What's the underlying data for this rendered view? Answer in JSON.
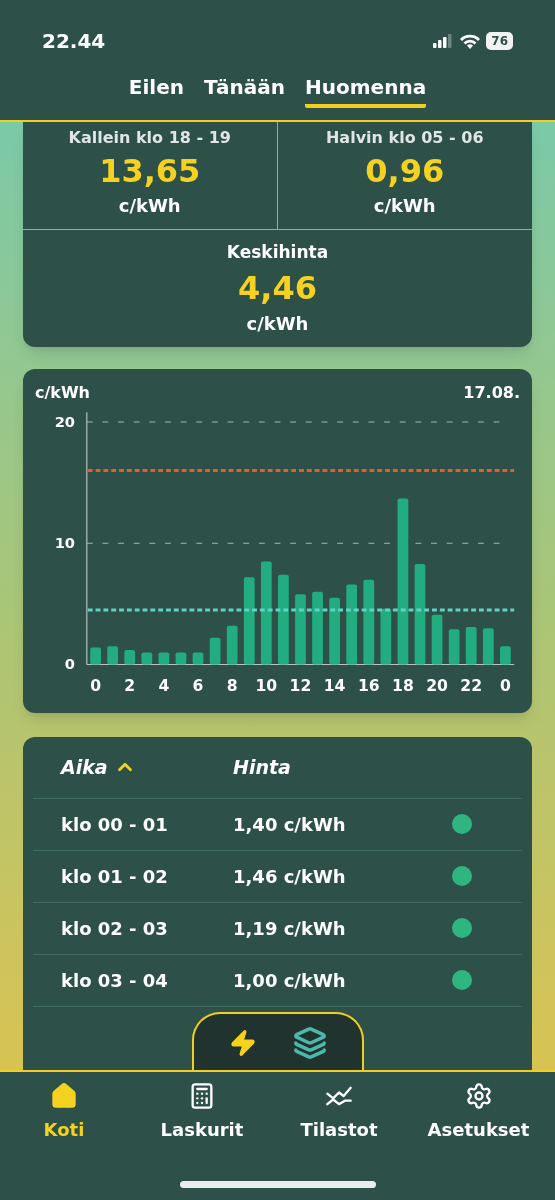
{
  "status_bar": {
    "time": "22.44",
    "battery": "76"
  },
  "tabs": [
    {
      "label": "Eilen",
      "selected": false
    },
    {
      "label": "Tänään",
      "selected": false
    },
    {
      "label": "Huomenna",
      "selected": true
    }
  ],
  "summary": {
    "highest": {
      "label": "Kallein klo 18 - 19",
      "value": "13,65",
      "unit": "c/kWh"
    },
    "lowest": {
      "label": "Halvin klo 05 - 06",
      "value": "0,96",
      "unit": "c/kWh"
    },
    "average": {
      "label": "Keskihinta",
      "value": "4,46",
      "unit": "c/kWh"
    }
  },
  "chart": {
    "date": "17.08.",
    "next_day_tick": "0",
    "chart_data": {
      "type": "bar",
      "ylabel": "c/kWh",
      "x": [
        0,
        1,
        2,
        3,
        4,
        5,
        6,
        7,
        8,
        9,
        10,
        11,
        12,
        13,
        14,
        15,
        16,
        17,
        18,
        19,
        20,
        21,
        22,
        23,
        24
      ],
      "xticks": [
        {
          "value": 0,
          "label": "0"
        },
        {
          "value": 2,
          "label": "2"
        },
        {
          "value": 4,
          "label": "4"
        },
        {
          "value": 6,
          "label": "6"
        },
        {
          "value": 8,
          "label": "8"
        },
        {
          "value": 10,
          "label": "10"
        },
        {
          "value": 12,
          "label": "12"
        },
        {
          "value": 14,
          "label": "14"
        },
        {
          "value": 16,
          "label": "16"
        },
        {
          "value": 18,
          "label": "18"
        },
        {
          "value": 20,
          "label": "20"
        },
        {
          "value": 22,
          "label": "22"
        }
      ],
      "xlim": [
        -0.5,
        24.5
      ],
      "series": [
        {
          "color": "#22ad80",
          "values": [
            1.4,
            1.5,
            1.2,
            1.0,
            1.0,
            1.0,
            1.0,
            2.2,
            3.2,
            7.2,
            8.5,
            7.4,
            5.8,
            6.0,
            5.5,
            6.6,
            7.0,
            4.6,
            13.7,
            8.3,
            4.1,
            2.9,
            3.1,
            3.0,
            1.5
          ]
        }
      ],
      "ylim": [
        0,
        20
      ],
      "yticks": [
        0,
        10,
        20
      ],
      "ref_lines": [
        {
          "axis": "y",
          "value": 16,
          "color": "#e0602a"
        },
        {
          "axis": "y",
          "value": 4.5,
          "color": "#5fd3c4"
        }
      ]
    }
  },
  "table": {
    "columns": [
      {
        "label": "Aika",
        "sorted": true
      },
      {
        "label": "Hinta",
        "sorted": false
      }
    ],
    "rows": [
      {
        "time": "klo 00 - 01",
        "price": "1,40 c/kWh",
        "color": "#2fb57f"
      },
      {
        "time": "klo 01 - 02",
        "price": "1,46 c/kWh",
        "color": "#2fb57f"
      },
      {
        "time": "klo 02 - 03",
        "price": "1,19 c/kWh",
        "color": "#2fb57f"
      },
      {
        "time": "klo 03 - 04",
        "price": "1,00 c/kWh",
        "color": "#2fb57f"
      }
    ]
  },
  "view_switch": [
    {
      "kind": "bolt",
      "selected": true
    },
    {
      "kind": "layers",
      "selected": false
    }
  ],
  "nav": [
    {
      "label": "Koti",
      "selected": true
    },
    {
      "label": "Laskurit",
      "selected": false
    },
    {
      "label": "Tilastot",
      "selected": false
    },
    {
      "label": "Asetukset",
      "selected": false
    }
  ]
}
